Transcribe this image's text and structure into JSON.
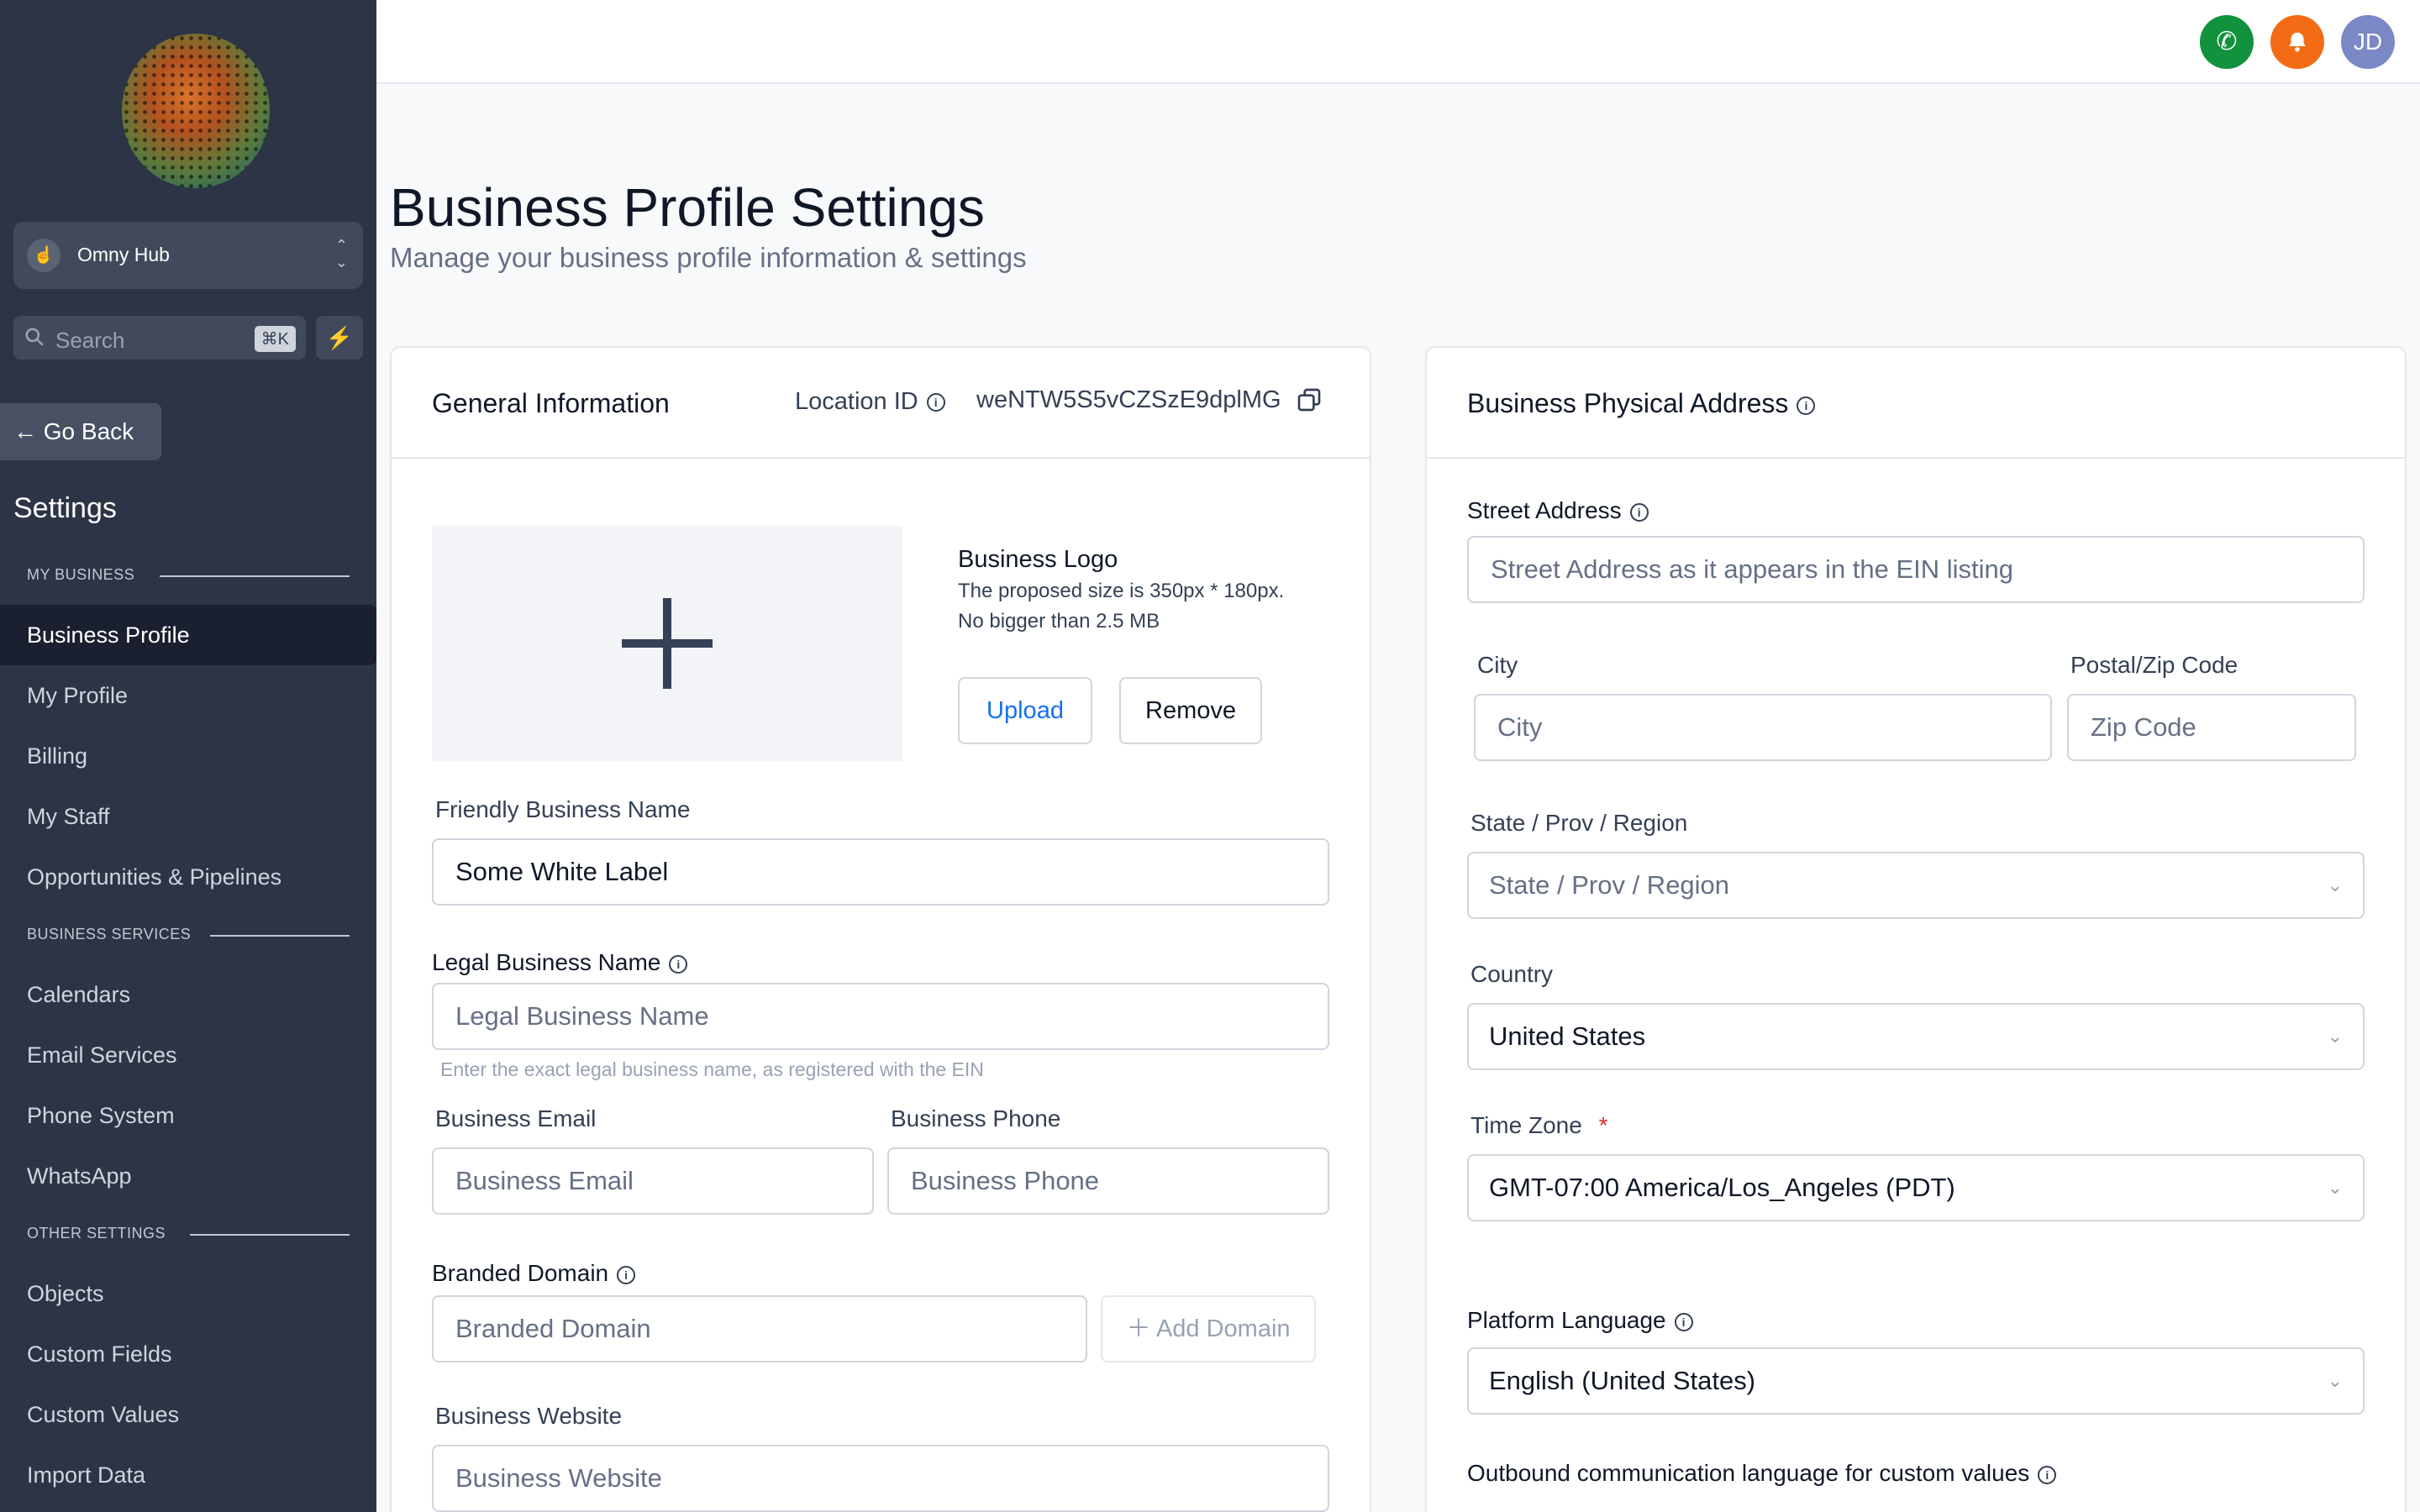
{
  "sidebar": {
    "hub_name": "Omny Hub",
    "search_placeholder": "Search",
    "search_shortcut": "⌘K",
    "go_back": "Go Back",
    "settings_title": "Settings",
    "sections": {
      "my_business": "MY BUSINESS",
      "business_services": "BUSINESS SERVICES",
      "other_settings": "OTHER SETTINGS"
    },
    "items": [
      {
        "label": "Business Profile",
        "active": true
      },
      {
        "label": "My Profile"
      },
      {
        "label": "Billing"
      },
      {
        "label": "My Staff"
      },
      {
        "label": "Opportunities & Pipelines"
      },
      {
        "label": "Calendars"
      },
      {
        "label": "Email Services"
      },
      {
        "label": "Phone System"
      },
      {
        "label": "WhatsApp"
      },
      {
        "label": "Objects"
      },
      {
        "label": "Custom Fields"
      },
      {
        "label": "Custom Values"
      },
      {
        "label": "Import Data"
      }
    ]
  },
  "topbar": {
    "avatar_initials": "JD",
    "phone_color": "#12923d",
    "bell_color": "#f36c15",
    "avatar_color": "#7b88c6"
  },
  "page": {
    "title": "Business Profile Settings",
    "subtitle": "Manage your business profile information & settings"
  },
  "general": {
    "title": "General Information",
    "location_label": "Location ID",
    "location_id": "weNTW5S5vCZSzE9dplMG",
    "logo_title": "Business Logo",
    "logo_hint1": "The proposed size is 350px * 180px.",
    "logo_hint2": "No bigger than 2.5 MB",
    "upload": "Upload",
    "remove": "Remove",
    "friendly_label": "Friendly Business Name",
    "friendly_value": "Some White Label",
    "legal_label": "Legal Business Name",
    "legal_placeholder": "Legal Business Name",
    "legal_hint": "Enter the exact legal business name, as registered with the EIN",
    "email_label": "Business Email",
    "email_placeholder": "Business Email",
    "phone_label": "Business Phone",
    "phone_placeholder": "Business Phone",
    "domain_label": "Branded Domain",
    "domain_placeholder": "Branded Domain",
    "add_domain": "Add Domain",
    "website_label": "Business Website",
    "website_placeholder": "Business Website"
  },
  "address": {
    "title": "Business Physical Address",
    "street_label": "Street Address",
    "street_placeholder": "Street Address as it appears in the EIN listing",
    "city_label": "City",
    "city_placeholder": "City",
    "zip_label": "Postal/Zip Code",
    "zip_placeholder": "Zip Code",
    "state_label": "State / Prov / Region",
    "state_value": "State / Prov / Region",
    "country_label": "Country",
    "country_value": "United States",
    "tz_label": "Time Zone",
    "tz_required": "*",
    "tz_value": "GMT-07:00 America/Los_Angeles (PDT)",
    "lang_label": "Platform Language",
    "lang_value": "English (United States)",
    "outbound_label": "Outbound communication language for custom values"
  }
}
